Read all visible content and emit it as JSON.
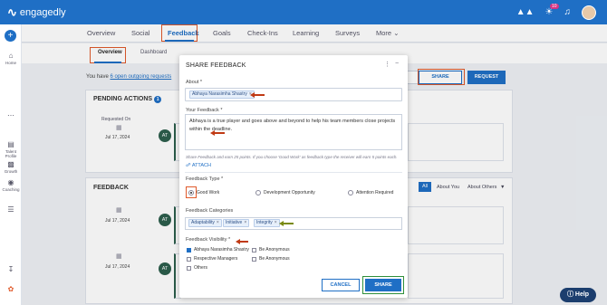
{
  "brand": {
    "name": "engagedly"
  },
  "topbar": {
    "notification_count": "10"
  },
  "rail": {
    "items": [
      {
        "label": "Home",
        "icon": "home-icon"
      },
      {
        "label": "Talent Profile",
        "icon": "profile-icon"
      },
      {
        "label": "Growth",
        "icon": "growth-icon"
      },
      {
        "label": "Coaching",
        "icon": "coaching-icon"
      }
    ]
  },
  "main_tabs": [
    "Overview",
    "Social",
    "Feedback",
    "Goals",
    "Check-Ins",
    "Learning",
    "Surveys",
    "More"
  ],
  "sub_tabs": [
    "Overview",
    "Dashboard"
  ],
  "info": {
    "prefix": "You have",
    "link": "6 open outgoing requests"
  },
  "actions": {
    "share": "SHARE",
    "request": "REQUEST"
  },
  "pending": {
    "title": "PENDING ACTIONS",
    "count": "1",
    "requested_on": "Requested On",
    "date": "Jul 17, 2024",
    "initials": "AT"
  },
  "feedback_section": {
    "title": "FEEDBACK",
    "filters": [
      "All",
      "About You",
      "About Others"
    ],
    "dates": [
      "Jul 17, 2024",
      "Jul 17, 2024"
    ],
    "initials": "AT"
  },
  "modal": {
    "title": "SHARE FEEDBACK",
    "about_label": "About *",
    "about_chip": "Abhaya Narasimha Shastry",
    "your_feedback_label": "Your Feedback *",
    "feedback_text": "Abhaya is a true player and goes above and beyond to help his team members close projects within the deadline.",
    "hint": "Share Feedback and earn 25 points. If you choose 'Good Work' as feedback type the receiver will earn 5 points each.",
    "attach": "ATTACH",
    "type_label": "Feedback Type *",
    "types": [
      "Good Work",
      "Development Opportunity",
      "Attention Required"
    ],
    "selected_type": "Good Work",
    "categories_label": "Feedback Categories",
    "categories": [
      "Adaptability",
      "Initiative",
      "Integrity"
    ],
    "visibility_label": "Feedback Visibility *",
    "visibility": [
      {
        "label": "Abhaya Narasimha Shastry",
        "checked": true
      },
      {
        "label": "Be Anonymous",
        "checked": false
      },
      {
        "label": "Respective Managers",
        "checked": false
      },
      {
        "label": "Be Anonymous",
        "checked": false
      },
      {
        "label": "Others",
        "checked": false
      }
    ],
    "cancel": "CANCEL",
    "share": "SHARE"
  },
  "help": "Help",
  "colors": {
    "brand": "#1f6fc5",
    "highlight_red": "#e05a2b",
    "highlight_green": "#2f8f3a"
  }
}
